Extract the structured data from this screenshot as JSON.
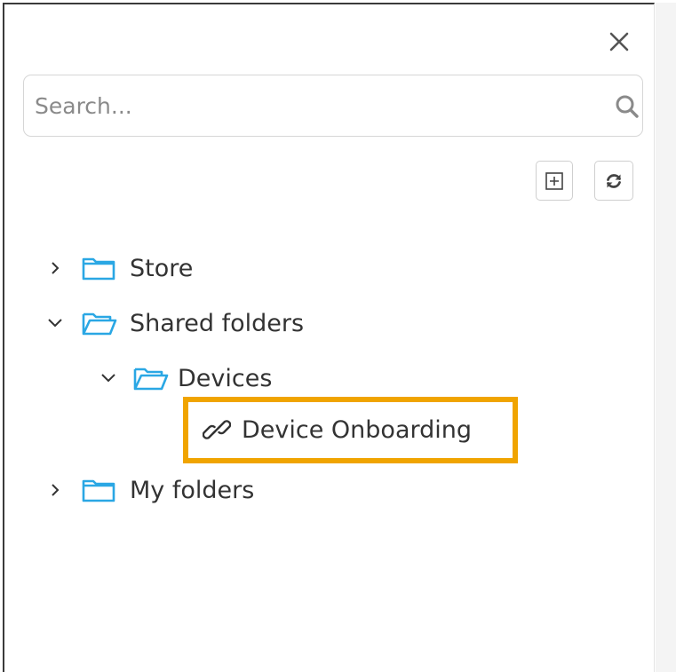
{
  "panel": {
    "close_icon": "close-icon",
    "search": {
      "placeholder": "Search...",
      "value": "",
      "icon": "search-icon"
    },
    "toolbar": {
      "expand_icon": "plus-square-icon",
      "refresh_icon": "refresh-icon"
    },
    "tree": {
      "items": [
        {
          "label": "Store",
          "expanded": false,
          "icon": "folder-icon"
        },
        {
          "label": "Shared folders",
          "expanded": true,
          "icon": "folder-open-icon",
          "children": [
            {
              "label": "Devices",
              "expanded": true,
              "icon": "folder-open-icon",
              "children": [
                {
                  "label": "Device Onboarding",
                  "icon": "link-icon",
                  "highlighted": true
                }
              ]
            }
          ]
        },
        {
          "label": "My folders",
          "expanded": false,
          "icon": "folder-icon"
        }
      ]
    }
  },
  "colors": {
    "folder": "#2aa7e4",
    "highlight": "#f0a400",
    "text": "#333333",
    "border": "#d6d6d6"
  }
}
